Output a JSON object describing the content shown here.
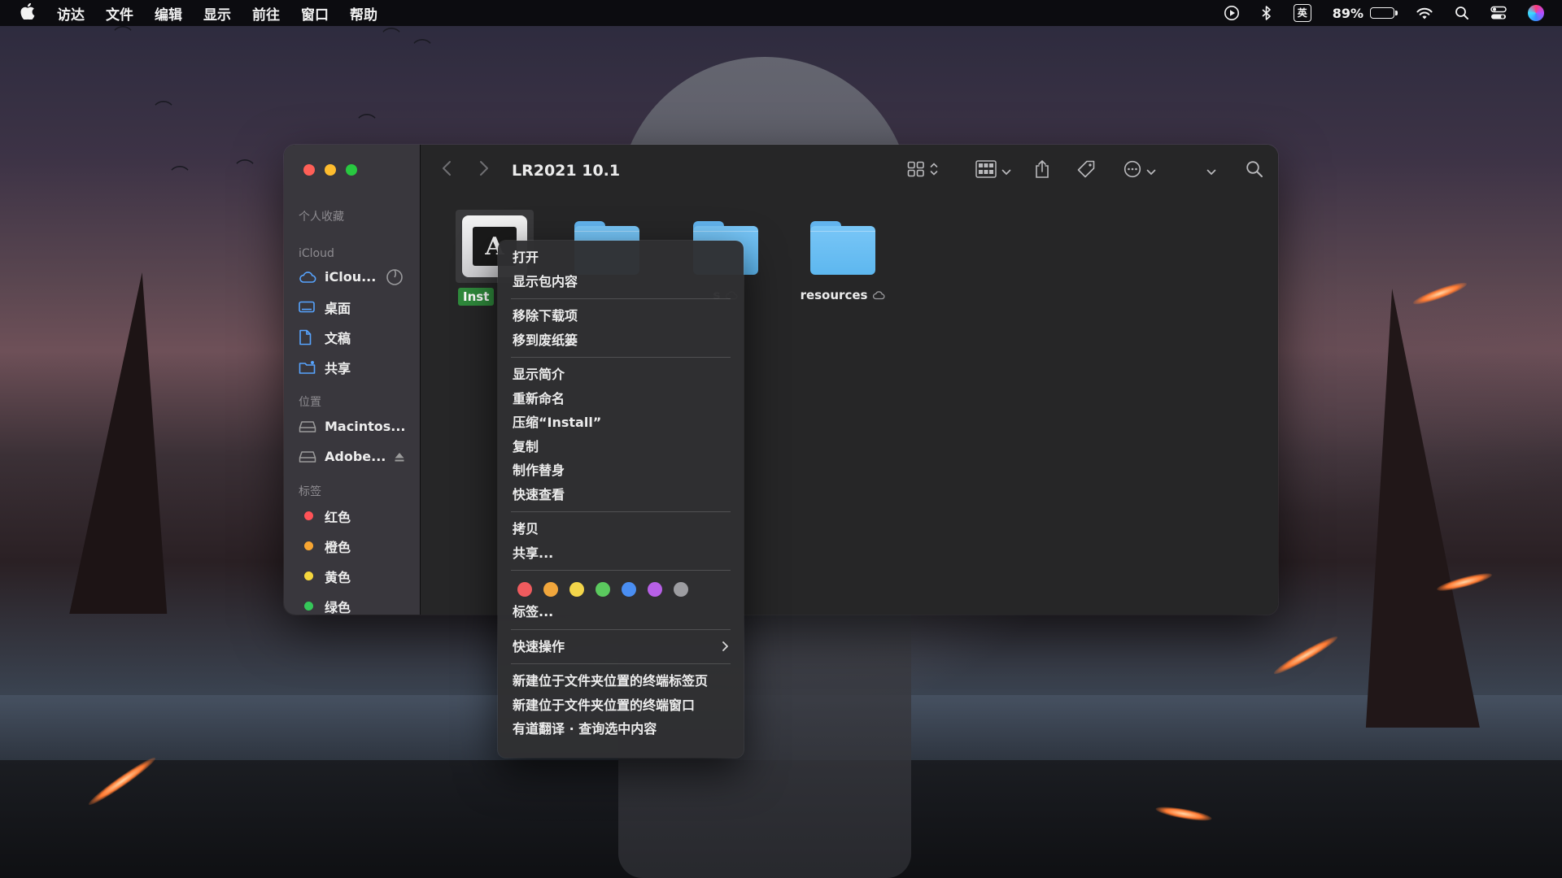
{
  "menubar": {
    "items": [
      "访达",
      "文件",
      "编辑",
      "显示",
      "前往",
      "窗口",
      "帮助"
    ],
    "ime_label": "英",
    "battery_percent": "89%",
    "battery_level": 0.89
  },
  "finder": {
    "title": "LR2021 10.1",
    "sidebar": {
      "favorites_header": "个人收藏",
      "icloud_header": "iCloud",
      "icloud_items": [
        "iClou...",
        "桌面",
        "文稿",
        "共享"
      ],
      "locations_header": "位置",
      "location_items": [
        "Macintos...",
        "Adobe..."
      ],
      "tags_header": "标签",
      "tag_items": [
        {
          "label": "红色",
          "color": "#ff5257"
        },
        {
          "label": "橙色",
          "color": "#f7a532"
        },
        {
          "label": "黄色",
          "color": "#f5d63d"
        },
        {
          "label": "绿色",
          "color": "#35c759"
        }
      ]
    },
    "files": [
      {
        "name": "Inst",
        "type": "app"
      },
      {
        "name": "",
        "type": "folder"
      },
      {
        "name": "s",
        "type": "folder"
      },
      {
        "name": "resources",
        "type": "folder"
      }
    ]
  },
  "context_menu": {
    "group1": [
      "打开",
      "显示包内容"
    ],
    "group2": [
      "移除下载项",
      "移到废纸篓"
    ],
    "group3": [
      "显示简介",
      "重新命名",
      "压缩“Install”",
      "复制",
      "制作替身",
      "快速查看"
    ],
    "group4": [
      "拷贝",
      "共享..."
    ],
    "tag_colors": [
      "#ef5b5e",
      "#f1a63c",
      "#f3d54a",
      "#5bc95e",
      "#4a8ef2",
      "#b760e6",
      "#9d9da1"
    ],
    "tags_label": "标签...",
    "quick_actions": "快速操作",
    "services": [
      "新建位于文件夹位置的终端标签页",
      "新建位于文件夹位置的终端窗口",
      "有道翻译 · 查询选中内容"
    ]
  }
}
